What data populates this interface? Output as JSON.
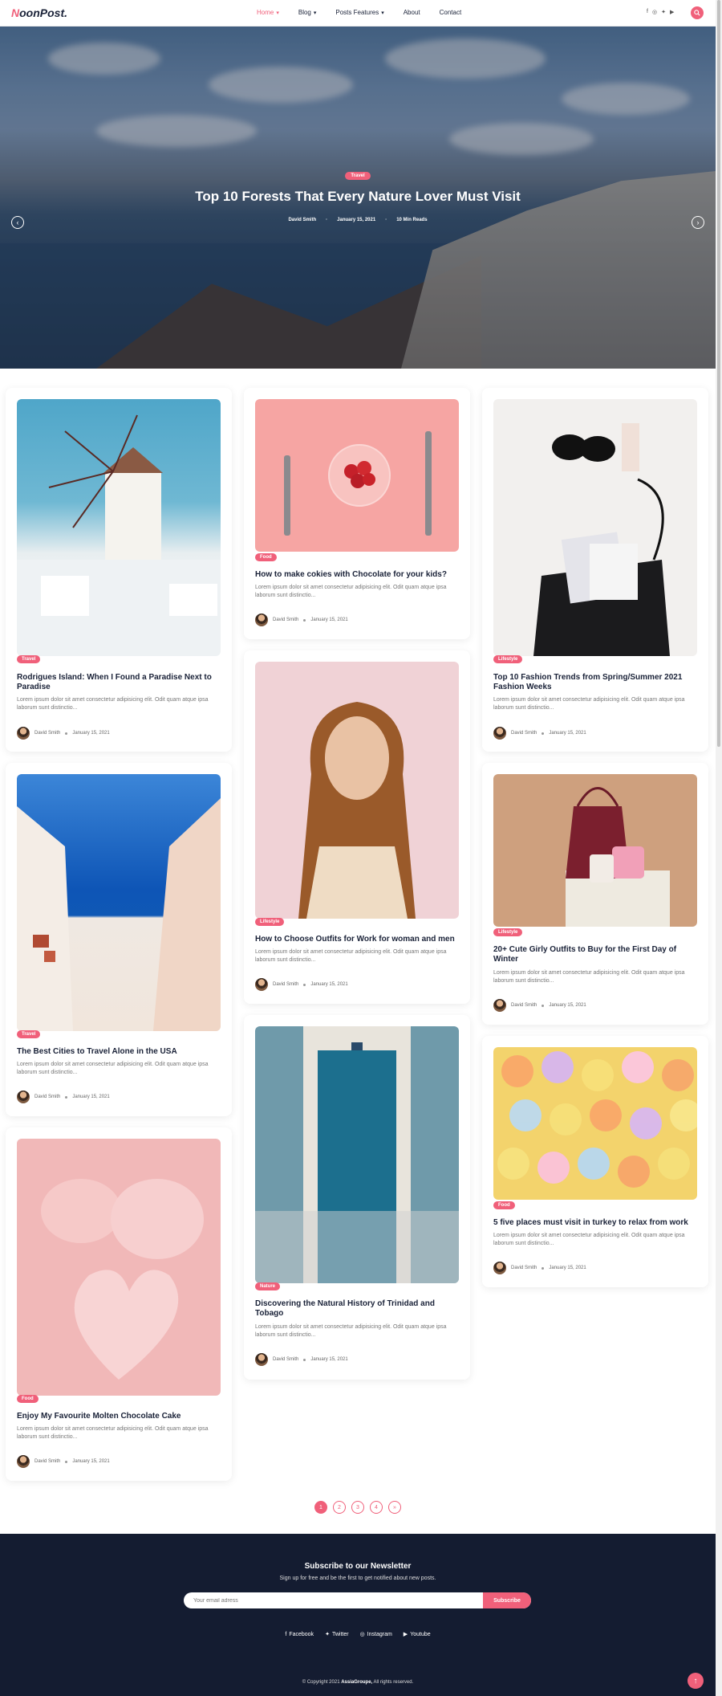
{
  "header": {
    "logo_first": "N",
    "logo_rest": "oonPost.",
    "nav": [
      "Home",
      "Blog",
      "Posts Features",
      "About",
      "Contact"
    ]
  },
  "hero": {
    "category": "Travel",
    "title": "Top 10 Forests That Every Nature Lover Must Visit",
    "author": "David Smith",
    "date": "January 15, 2021",
    "reads": "10 Min Reads"
  },
  "posts": [
    {
      "category": "Travel",
      "title": "Rodrigues Island: When I Found a Paradise Next to Paradise",
      "excerpt": "Lorem ipsum dolor sit amet consectetur adipisicing elit. Odit quam atque ipsa laborum sunt distinctio...",
      "author": "David Smith",
      "date": "January 15, 2021"
    },
    {
      "category": "Food",
      "title": "How to make cokies with Chocolate for your kids?",
      "excerpt": "Lorem ipsum dolor sit amet consectetur adipisicing elit. Odit quam atque ipsa laborum sunt distinctio...",
      "author": "David Smith",
      "date": "January 15, 2021"
    },
    {
      "category": "Lifestyle",
      "title": "Top 10 Fashion Trends from Spring/Summer 2021 Fashion Weeks",
      "excerpt": "Lorem ipsum dolor sit amet consectetur adipisicing elit. Odit quam atque ipsa laborum sunt distinctio...",
      "author": "David Smith",
      "date": "January 15, 2021"
    },
    {
      "category": "Travel",
      "title": "The Best Cities to Travel Alone in the USA",
      "excerpt": "Lorem ipsum dolor sit amet consectetur adipisicing elit. Odit quam atque ipsa laborum sunt distinctio...",
      "author": "David Smith",
      "date": "January 15, 2021"
    },
    {
      "category": "Lifestyle",
      "title": "How to Choose Outfits for Work for woman and men",
      "excerpt": "Lorem ipsum dolor sit amet consectetur adipisicing elit. Odit quam atque ipsa laborum sunt distinctio...",
      "author": "David Smith",
      "date": "January 15, 2021"
    },
    {
      "category": "Lifestyle",
      "title": "20+ Cute Girly Outfits to Buy for the First Day of Winter",
      "excerpt": "Lorem ipsum dolor sit amet consectetur adipisicing elit. Odit quam atque ipsa laborum sunt distinctio...",
      "author": "David Smith",
      "date": "January 15, 2021"
    },
    {
      "category": "Food",
      "title": "Enjoy My Favourite Molten Chocolate Cake",
      "excerpt": "Lorem ipsum dolor sit amet consectetur adipisicing elit. Odit quam atque ipsa laborum sunt distinctio...",
      "author": "David Smith",
      "date": "January 15, 2021"
    },
    {
      "category": "Nature",
      "title": "Discovering the Natural History of Trinidad and Tobago",
      "excerpt": "Lorem ipsum dolor sit amet consectetur adipisicing elit. Odit quam atque ipsa laborum sunt distinctio...",
      "author": "David Smith",
      "date": "January 15, 2021"
    },
    {
      "category": "Food",
      "title": "5 five places must visit in turkey to relax from work",
      "excerpt": "Lorem ipsum dolor sit amet consectetur adipisicing elit. Odit quam atque ipsa laborum sunt distinctio...",
      "author": "David Smith",
      "date": "January 15, 2021"
    }
  ],
  "pagination": [
    "1",
    "2",
    "3",
    "4",
    "»"
  ],
  "newsletter": {
    "title": "Subscribe to our Newsletter",
    "subtitle": "Sign up for free and be the first to get notified about new posts.",
    "placeholder": "Your email adress",
    "button": "Subscribe"
  },
  "footer_links": [
    "Facebook",
    "Twitter",
    "Instagram",
    "Youtube"
  ],
  "copyright_prefix": "© Copyright 2021 ",
  "copyright_brand": "AssiaGroupe,",
  "copyright_suffix": " All rights reserved."
}
